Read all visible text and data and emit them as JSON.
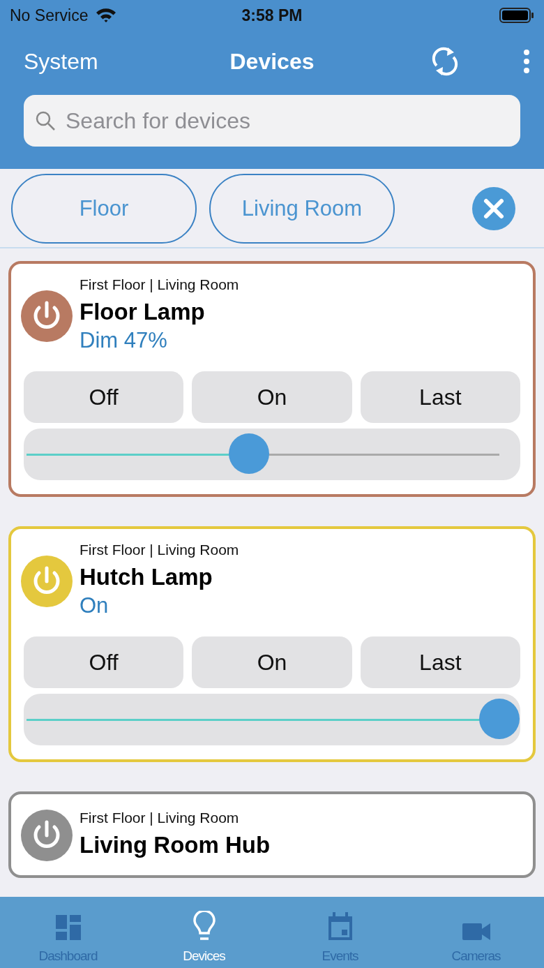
{
  "status_bar": {
    "carrier": "No Service",
    "time": "3:58 PM"
  },
  "header": {
    "back": "System",
    "title": "Devices"
  },
  "search": {
    "placeholder": "Search for devices"
  },
  "filters": [
    {
      "label": "Floor"
    },
    {
      "label": "Living Room"
    }
  ],
  "devices": [
    {
      "location": "First Floor | Living Room",
      "name": "Floor Lamp",
      "status": "Dim 47%",
      "color": "#b87a62",
      "buttons": [
        "Off",
        "On",
        "Last"
      ],
      "level": 0.47
    },
    {
      "location": "First Floor | Living Room",
      "name": "Hutch Lamp",
      "status": "On",
      "color": "#e4c83e",
      "buttons": [
        "Off",
        "On",
        "Last"
      ],
      "level": 1
    },
    {
      "location": "First Floor | Living Room",
      "name": "Living Room Hub",
      "color": "#8f8f8f"
    }
  ],
  "tabs": [
    {
      "label": "Dashboard",
      "kind": "dashboard",
      "selected": false
    },
    {
      "label": "Devices",
      "kind": "devices",
      "selected": true
    },
    {
      "label": "Events",
      "kind": "events",
      "selected": false
    },
    {
      "label": "Cameras",
      "kind": "cameras",
      "selected": false
    }
  ]
}
